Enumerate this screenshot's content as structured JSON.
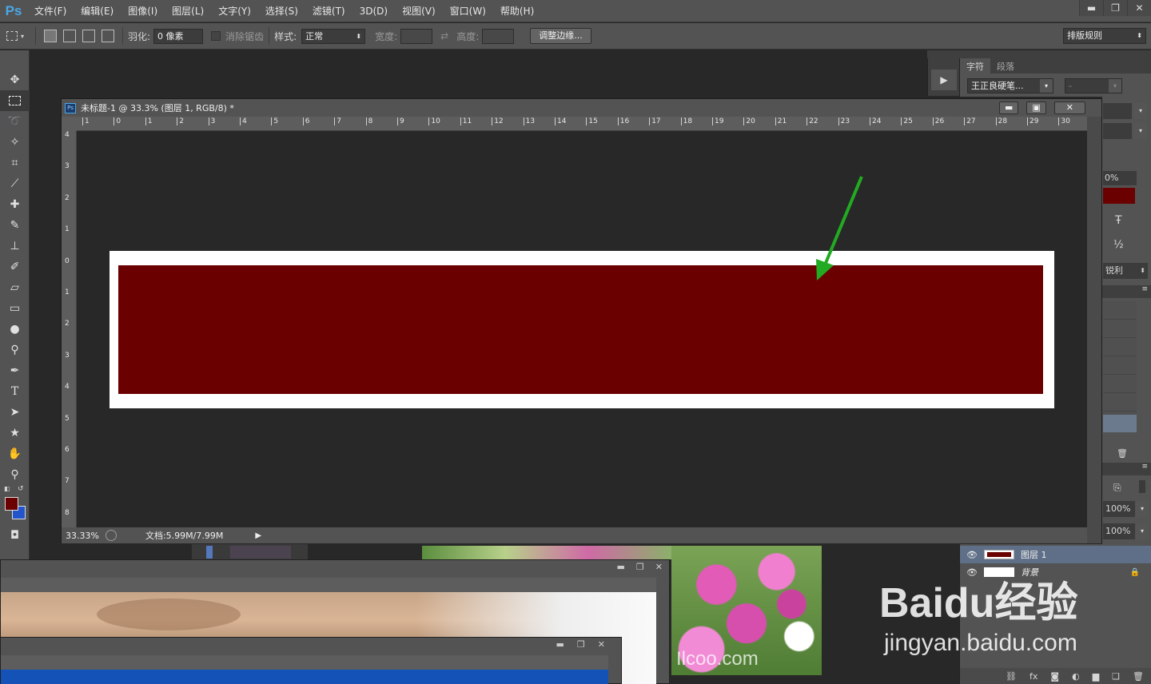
{
  "app": {
    "logo": "Ps",
    "menu": [
      "文件(F)",
      "编辑(E)",
      "图像(I)",
      "图层(L)",
      "文字(Y)",
      "选择(S)",
      "滤镜(T)",
      "3D(D)",
      "视图(V)",
      "窗口(W)",
      "帮助(H)"
    ]
  },
  "options": {
    "feather_label": "羽化:",
    "feather_value": "0 像素",
    "antialias_label": "消除锯齿",
    "style_label": "样式:",
    "style_value": "正常",
    "width_label": "宽度:",
    "height_label": "高度:",
    "refine_edge": "调整边缘...",
    "workspace": "排版规则"
  },
  "document": {
    "title": "未标题-1 @ 33.3% (图层 1, RGB/8) *",
    "zoom": "33.33%",
    "doc_size": "文档:5.99M/7.99M",
    "ruler_h": [
      "1",
      "0",
      "1",
      "2",
      "3",
      "4",
      "5",
      "6",
      "7",
      "8",
      "9",
      "10",
      "11",
      "12",
      "13",
      "14",
      "15",
      "16",
      "17",
      "18",
      "19",
      "20",
      "21",
      "22",
      "23",
      "24",
      "25",
      "26",
      "27",
      "28",
      "29",
      "30"
    ],
    "ruler_v": [
      "4",
      "3",
      "2",
      "1",
      "0",
      "1",
      "2",
      "3",
      "4",
      "5",
      "6",
      "7",
      "8"
    ],
    "fill_color": "#6b0000",
    "arrow_color": "#22aa22"
  },
  "character_panel": {
    "tabs": [
      "字符",
      "段落"
    ],
    "font": "王正良硬笔...",
    "style": "-",
    "percent": "0%",
    "swatch_color": "#6b0000",
    "aa_label": "锐利",
    "half": "½"
  },
  "layers": {
    "opacity": "100%",
    "fill": "100%",
    "items": [
      {
        "name": "图层 1",
        "selected": true
      },
      {
        "name": "背景",
        "locked": true
      }
    ]
  },
  "tools": {
    "fg_color": "#6b0000",
    "bg_color": "#2255cc"
  },
  "watermark": {
    "brand": "Baidu经验",
    "url": "jingyan.baidu.com"
  },
  "bg_text": "Ilcoo.com"
}
